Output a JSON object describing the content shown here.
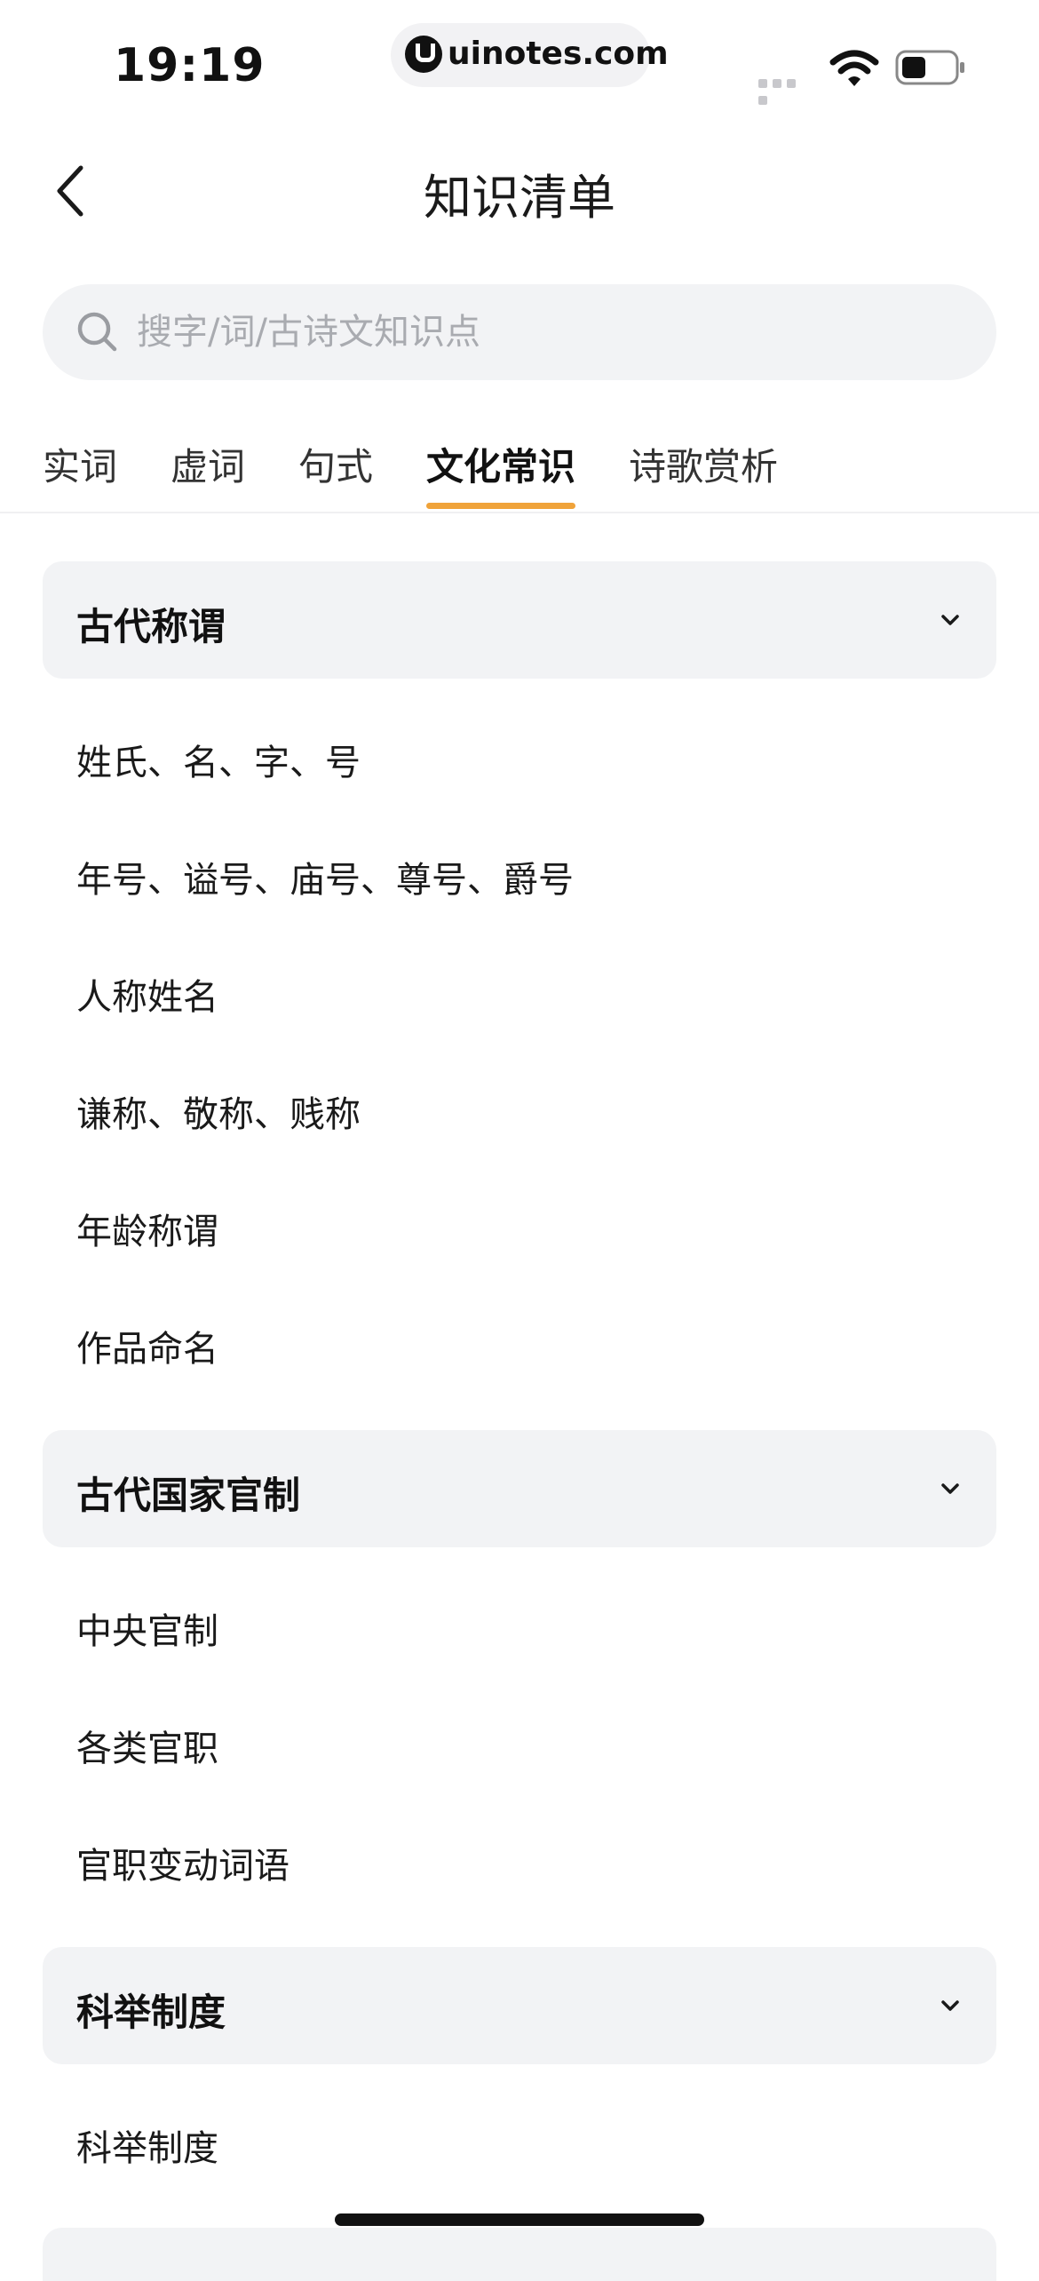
{
  "status_bar": {
    "time": "19:19",
    "url": "uinotes.com"
  },
  "nav": {
    "title": "知识清单"
  },
  "search": {
    "placeholder": "搜字/词/古诗文知识点"
  },
  "tabs": [
    {
      "label": "实词"
    },
    {
      "label": "虚词"
    },
    {
      "label": "句式"
    },
    {
      "label": "文化常识",
      "active": true
    },
    {
      "label": "诗歌赏析"
    }
  ],
  "sections": [
    {
      "title": "古代称谓",
      "items": [
        {
          "label": "姓氏、名、字、号"
        },
        {
          "label": "年号、谥号、庙号、尊号、爵号"
        },
        {
          "label": "人称姓名"
        },
        {
          "label": "谦称、敬称、贱称"
        },
        {
          "label": "年龄称谓"
        },
        {
          "label": "作品命名"
        }
      ]
    },
    {
      "title": "古代国家官制",
      "items": [
        {
          "label": "中央官制"
        },
        {
          "label": "各类官职"
        },
        {
          "label": "官职变动词语"
        }
      ]
    },
    {
      "title": "科举制度",
      "items": [
        {
          "label": "科举制度"
        }
      ]
    }
  ],
  "colors": {
    "accent": "#f0a33a",
    "section_bg": "#f2f3f5",
    "placeholder": "#a9abb0"
  }
}
